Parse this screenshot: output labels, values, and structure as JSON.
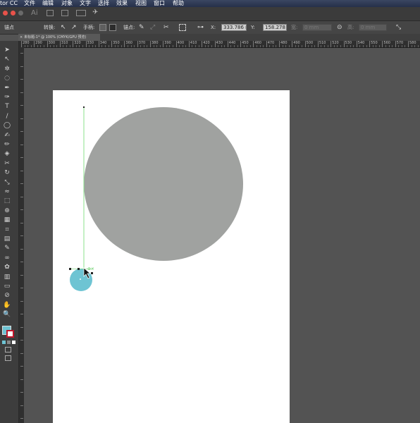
{
  "menubar": {
    "app_name": "tor CC",
    "items": [
      "文件",
      "编辑",
      "对象",
      "文字",
      "选择",
      "效果",
      "视图",
      "窗口",
      "帮助"
    ]
  },
  "appbar": {
    "logo": "Ai"
  },
  "control_bar": {
    "anchor_label": "锚点",
    "convert_label": "转换:",
    "handles_label": "手柄:",
    "anchors_label": "锚点:",
    "x_value": "333.786 n",
    "y_value": "158.278 n",
    "w_label": "宽:",
    "w_value": "0 mm",
    "h_label": "高:",
    "h_value": "0 mm"
  },
  "document_tab": {
    "close": "×",
    "title": "未标题-1* @ 100% (CMYK/GPU 预览)"
  },
  "ruler": {
    "labels": [
      "280",
      "290",
      "300",
      "310",
      "320",
      "330",
      "340",
      "350",
      "360",
      "370",
      "380",
      "390",
      "400",
      "410",
      "420",
      "430",
      "440",
      "450",
      "460",
      "470",
      "480",
      "490",
      "500",
      "510",
      "520",
      "530",
      "540",
      "550",
      "560",
      "570",
      "580"
    ]
  },
  "colors": {
    "gray_circle": "#a0a2a0",
    "blue_circle": "#6ec4d3",
    "path_line": "#8be08b",
    "fill_swatch": "#6ec4d3",
    "stroke_swatch": "#c0162b"
  },
  "tools": [
    "selection-tool",
    "direct-selection-tool",
    "magic-wand-tool",
    "lasso-tool",
    "pen-tool",
    "curvature-tool",
    "type-tool",
    "line-segment-tool",
    "ellipse-tool",
    "paintbrush-tool",
    "pencil-tool",
    "eraser-tool",
    "scissors-tool",
    "rotate-tool",
    "scale-tool",
    "width-tool",
    "free-transform-tool",
    "shape-builder-tool",
    "perspective-grid-tool",
    "mesh-tool",
    "gradient-tool",
    "eyedropper-tool",
    "blend-tool",
    "symbol-sprayer-tool",
    "column-graph-tool",
    "artboard-tool",
    "slice-tool",
    "hand-tool",
    "zoom-tool"
  ]
}
